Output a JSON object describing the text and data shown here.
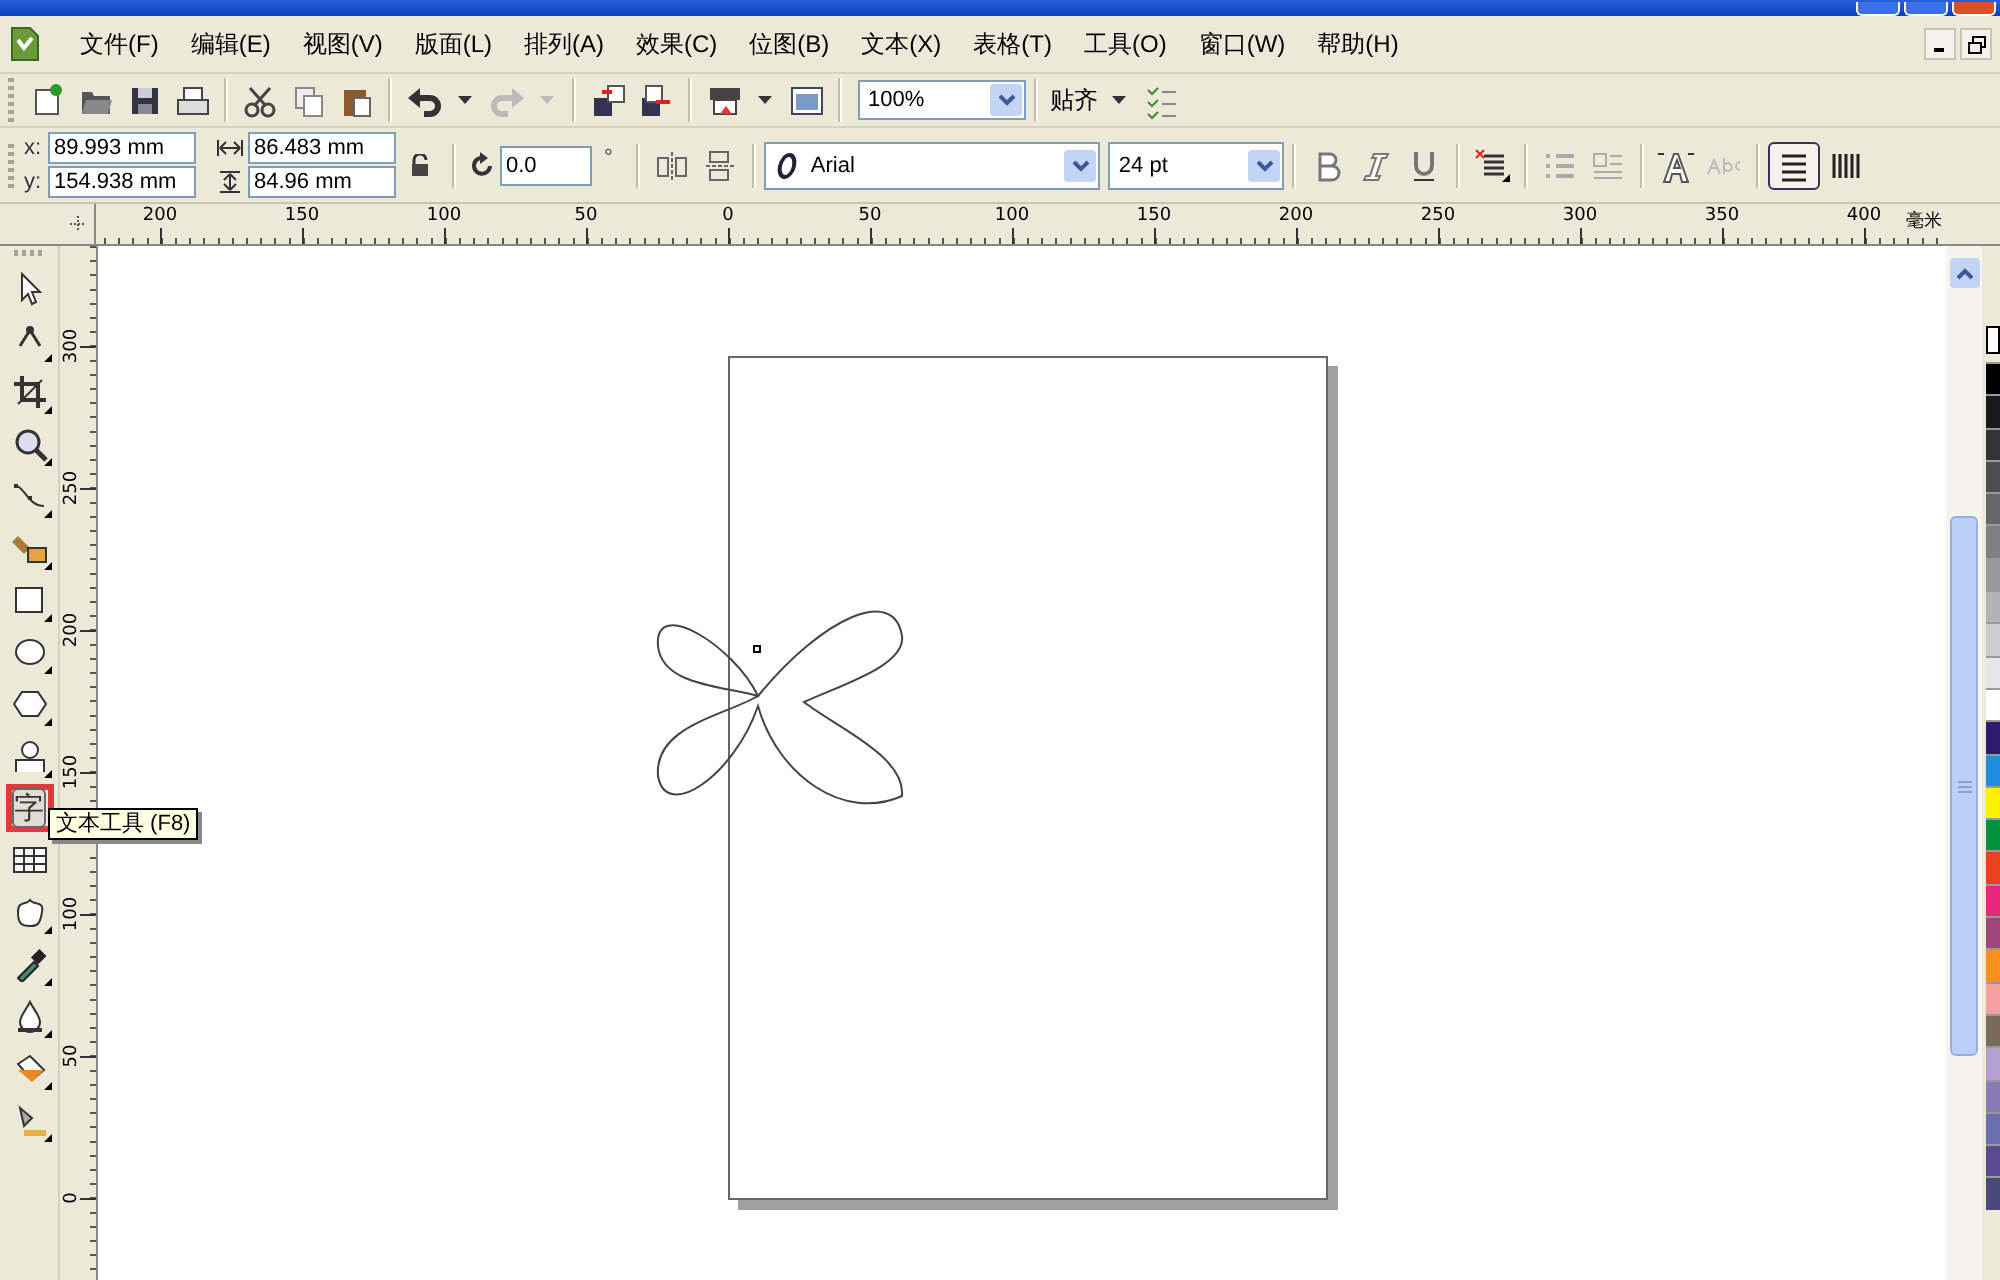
{
  "menu": [
    {
      "label": "文件(F)"
    },
    {
      "label": "编辑(E)"
    },
    {
      "label": "视图(V)"
    },
    {
      "label": "版面(L)"
    },
    {
      "label": "排列(A)"
    },
    {
      "label": "效果(C)"
    },
    {
      "label": "位图(B)"
    },
    {
      "label": "文本(X)"
    },
    {
      "label": "表格(T)"
    },
    {
      "label": "工具(O)"
    },
    {
      "label": "窗口(W)"
    },
    {
      "label": "帮助(H)"
    }
  ],
  "toolbar": {
    "zoom": "100%",
    "snap": "贴齐"
  },
  "property_bar": {
    "x_label": "x:",
    "x": "89.993 mm",
    "y_label": "y:",
    "y": "154.938 mm",
    "width": "86.483 mm",
    "height": "84.96 mm",
    "rotation": "0.0",
    "degree": "°",
    "font": "Arial",
    "font_size": "24 pt"
  },
  "toolbox": [
    {
      "kind": "pick",
      "selected": false
    },
    {
      "kind": "shape",
      "selected": false
    },
    {
      "kind": "crop",
      "selected": false
    },
    {
      "kind": "zoom",
      "selected": false
    },
    {
      "kind": "curve",
      "selected": false
    },
    {
      "kind": "smartfill",
      "selected": false
    },
    {
      "kind": "rectangle",
      "selected": false
    },
    {
      "kind": "ellipse",
      "selected": false
    },
    {
      "kind": "polygon",
      "selected": false
    },
    {
      "kind": "basicshape",
      "selected": false
    },
    {
      "kind": "text",
      "selected": true,
      "glyph": "字"
    },
    {
      "kind": "table",
      "selected": false
    },
    {
      "kind": "blend",
      "selected": false
    },
    {
      "kind": "eyedropper",
      "selected": false
    },
    {
      "kind": "outline",
      "selected": false
    },
    {
      "kind": "fill",
      "selected": false
    },
    {
      "kind": "interactivefill",
      "selected": false
    }
  ],
  "tooltip": "文本工具 (F8)",
  "ruler_top": {
    "labels": [
      "200",
      "150",
      "100",
      "50",
      "0",
      "50",
      "100",
      "150",
      "200",
      "250",
      "300",
      "350",
      "400"
    ],
    "unit": "毫米"
  },
  "ruler_left": {
    "labels": [
      "300",
      "250",
      "200",
      "150",
      "100",
      "50",
      "0"
    ]
  },
  "palette": [
    {
      "color": "#000000"
    },
    {
      "color": "#1a1a1a"
    },
    {
      "color": "#333333"
    },
    {
      "color": "#4d4d4d"
    },
    {
      "color": "#666666"
    },
    {
      "color": "#808080"
    },
    {
      "color": "#999999"
    },
    {
      "color": "#b3b3b3"
    },
    {
      "color": "#cccccc"
    },
    {
      "color": "#e6e6e6"
    },
    {
      "color": "#ffffff"
    },
    {
      "color": "#2e1a6e"
    },
    {
      "color": "#1e8ee0"
    },
    {
      "color": "#fff200"
    },
    {
      "color": "#00923f"
    },
    {
      "color": "#e8411e"
    },
    {
      "color": "#e4287c"
    },
    {
      "color": "#a0447c"
    },
    {
      "color": "#f7901e"
    },
    {
      "color": "#f5a0a0"
    },
    {
      "color": "#7a6a5a"
    },
    {
      "color": "#b4a0d0"
    },
    {
      "color": "#8a7ab8"
    },
    {
      "color": "#6a70b0"
    },
    {
      "color": "#5a4a90"
    },
    {
      "color": "#4a4a7a"
    }
  ]
}
